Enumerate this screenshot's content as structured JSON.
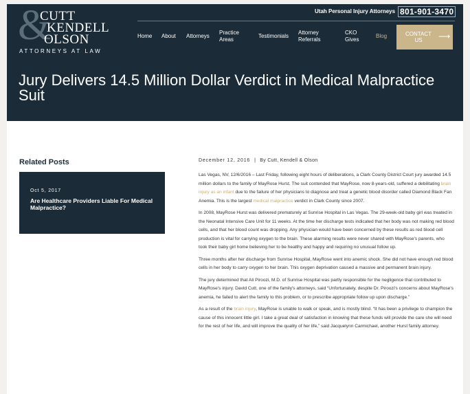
{
  "logo": {
    "line1": "CUTT",
    "line2": "KENDELL",
    "line3": "OLSON",
    "ampersand": "&",
    "tagline": "ATTORNEYS AT LAW"
  },
  "header": {
    "phone_label": "Utah Personal Injury Attorneys",
    "phone": "801-901-3470"
  },
  "nav": {
    "items": [
      {
        "label": "Home"
      },
      {
        "label": "About"
      },
      {
        "label": "Attorneys"
      },
      {
        "label": "Practice\nAreas"
      },
      {
        "label": "Testimonials"
      },
      {
        "label": "Attorney\nReferrals"
      },
      {
        "label": "CKO\nGives"
      },
      {
        "label": "Blog"
      }
    ],
    "cta": {
      "label": "CONTACT\nUS",
      "icon": "arrow-right-icon"
    }
  },
  "article": {
    "title": "Jury Delivers 14.5 Million Dollar Verdict in Medical Malpractice Suit",
    "date": "December 12, 2016",
    "separator": "|",
    "byline": "By Cutt, Kendell & Olson",
    "p1": {
      "a": "Las Vegas, NV, 12/6/2016 – Last Friday, following eight hours of deliberations, a Clark County District Court jury awarded 14.5 million dollars to the family of MayRose Hurst. The suit contended that MayRose, now 8-years-old, suffered a debilitating ",
      "link1": "brain injury as an infant",
      "b": " due to the failure of her physicians to diagnose and treat a genetic blood disorder called Diamond Black Fan Anemia. This is the largest ",
      "link2": "medical malpractice",
      "c": " verdict in Clark County since 2007."
    },
    "p2": "In 2008, MayRose Hurst was delivered prematurely at Sunrise Hospital in Las Vegas. The 29-week-old baby girl was treated in the Neonatal Intensive Care Unit for 11 weeks. At the time her discharge tests indicated that her body was not making red blood cells, and that her blood count was dropping. Any physician would have been concerned by these results as red blood cell production is vital for carrying oxygen to the brain. These alarming results were never shared with MayRose's parents, who took their baby girl home believing her to be healthy and happy and requiring no unusual follow up.",
    "p3": "Three months after her discharge from Sunrise Hospital, MayRose went into anemic shock. She did not have enough red blood cells in her body to carry oxygen to her brain. This oxygen deprivation caused a massive and permanent brain injury.",
    "p4": "The jury determined that Ali Piroozi, M.D. of Sunrise Hospital was partly responsible for the negligence that contributed to MayRose's injury. David Cutt, one of the family's attorneys, said “Unfortunately, despite Dr. Piroozi's concerns about MayRose's anemia, he failed to alert the family to this problem, or to prescribe appropriate follow up upon discharge.”",
    "p5": {
      "a": "As a result of the ",
      "link": "brain injury",
      "b": ", MayRose is unable to walk or speak, and is mostly blind. “It has been a privilege to champion the cause of this innocent little girl. I take a great deal of satisfaction in knowing that these funds will provide the care she will need for the rest of her life, and will improve the quality of her life,” said Jacquelynn Carmichael, another Hurst family attorney."
    }
  },
  "sidebar": {
    "heading": "Related Posts",
    "posts": [
      {
        "date": "Oct 5, 2017",
        "title": "Are Healthcare Providers Liable For Medical Malpractice?"
      }
    ]
  },
  "colors": {
    "navy": "#1b2c38",
    "gold": "#cbb58a",
    "link": "#c9ab74"
  }
}
